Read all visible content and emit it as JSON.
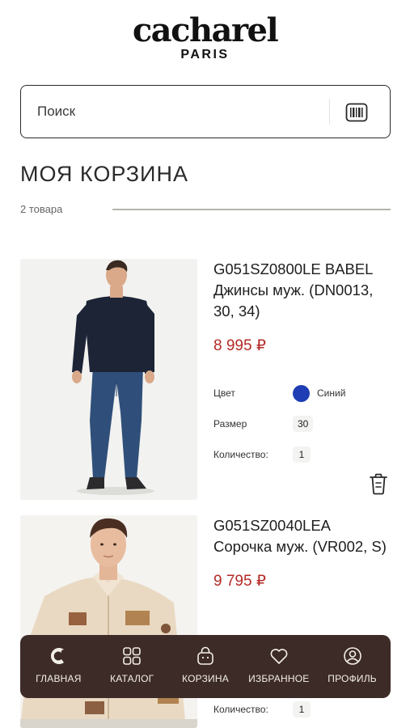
{
  "brand": {
    "name": "cacharel",
    "sub": "PARIS"
  },
  "search": {
    "placeholder": "Поиск"
  },
  "page": {
    "title": "МОЯ КОРЗИНА",
    "count": "2 товара"
  },
  "products": [
    {
      "name": "G051SZ0800LE BABEL Джинсы муж. (DN0013, 30, 34)",
      "price": "8 995 ₽",
      "color_label": "Цвет",
      "color_value": "Синий",
      "color_hex": "#1f3eb5",
      "size_label": "Размер",
      "size_value": "30",
      "qty_label": "Количество:",
      "qty_value": "1"
    },
    {
      "name": "G051SZ0040LEA Сорочка муж. (VR002, S)",
      "price": "9 795 ₽",
      "qty_label": "Количество:",
      "qty_value": "1"
    }
  ],
  "tabs": [
    {
      "label": "ГЛАВНАЯ",
      "icon": "cacharel-c-icon"
    },
    {
      "label": "КАТАЛОГ",
      "icon": "grid-icon"
    },
    {
      "label": "КОРЗИНА",
      "icon": "bag-icon"
    },
    {
      "label": "ИЗБРАННОЕ",
      "icon": "heart-icon"
    },
    {
      "label": "ПРОФИЛЬ",
      "icon": "profile-icon"
    }
  ],
  "colors": {
    "accent_price": "#b32a26",
    "tabbar": "#3d2b27"
  }
}
